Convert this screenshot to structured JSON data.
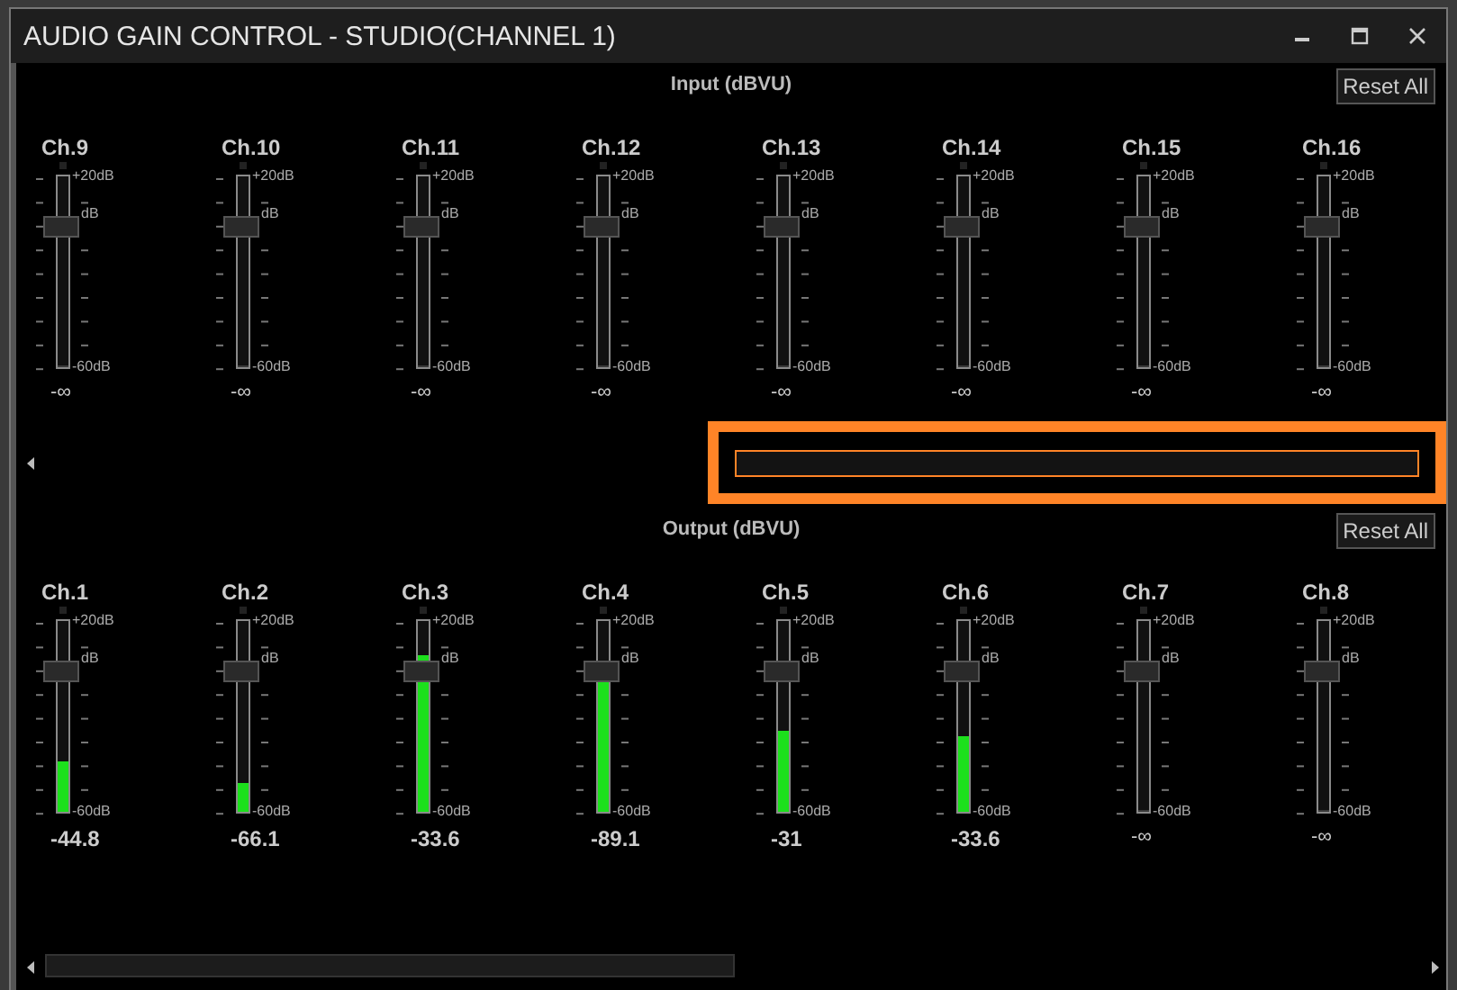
{
  "window": {
    "title": "AUDIO GAIN CONTROL - STUDIO(CHANNEL 1)"
  },
  "panels": [
    {
      "title": "Input (dBVU)",
      "reset_button": "Reset All",
      "channels": [
        {
          "name": "Ch.9",
          "scale_top": "+20dB",
          "scale_mid": "dB",
          "scale_bottom": "-60dB",
          "fader": {
            "level": 0.76
          },
          "meter": {
            "level": 0
          },
          "reading": "-∞"
        },
        {
          "name": "Ch.10",
          "scale_top": "+20dB",
          "scale_mid": "dB",
          "scale_bottom": "-60dB",
          "fader": {
            "level": 0.76
          },
          "meter": {
            "level": 0
          },
          "reading": "-∞"
        },
        {
          "name": "Ch.11",
          "scale_top": "+20dB",
          "scale_mid": "dB",
          "scale_bottom": "-60dB",
          "fader": {
            "level": 0.76
          },
          "meter": {
            "level": 0
          },
          "reading": "-∞"
        },
        {
          "name": "Ch.12",
          "scale_top": "+20dB",
          "scale_mid": "dB",
          "scale_bottom": "-60dB",
          "fader": {
            "level": 0.76
          },
          "meter": {
            "level": 0
          },
          "reading": "-∞"
        },
        {
          "name": "Ch.13",
          "scale_top": "+20dB",
          "scale_mid": "dB",
          "scale_bottom": "-60dB",
          "fader": {
            "level": 0.76
          },
          "meter": {
            "level": 0
          },
          "reading": "-∞"
        },
        {
          "name": "Ch.14",
          "scale_top": "+20dB",
          "scale_mid": "dB",
          "scale_bottom": "-60dB",
          "fader": {
            "level": 0.76
          },
          "meter": {
            "level": 0
          },
          "reading": "-∞"
        },
        {
          "name": "Ch.15",
          "scale_top": "+20dB",
          "scale_mid": "dB",
          "scale_bottom": "-60dB",
          "fader": {
            "level": 0.76
          },
          "meter": {
            "level": 0
          },
          "reading": "-∞"
        },
        {
          "name": "Ch.16",
          "scale_top": "+20dB",
          "scale_mid": "dB",
          "scale_bottom": "-60dB",
          "fader": {
            "level": 0.76
          },
          "meter": {
            "level": 0
          },
          "reading": "-∞"
        }
      ]
    },
    {
      "title": "Output (dBVU)",
      "reset_button": "Reset All",
      "channels": [
        {
          "name": "Ch.1",
          "scale_top": "+20dB",
          "scale_mid": "dB",
          "scale_bottom": "-60dB",
          "fader": {
            "level": 0.76
          },
          "meter": {
            "level": 0.26
          },
          "reading": "-44.8"
        },
        {
          "name": "Ch.2",
          "scale_top": "+20dB",
          "scale_mid": "dB",
          "scale_bottom": "-60dB",
          "fader": {
            "level": 0.76
          },
          "meter": {
            "level": 0.15
          },
          "reading": "-66.1"
        },
        {
          "name": "Ch.3",
          "scale_top": "+20dB",
          "scale_mid": "dB",
          "scale_bottom": "-60dB",
          "fader": {
            "level": 0.76
          },
          "meter": {
            "level": 0.82
          },
          "reading": "-33.6"
        },
        {
          "name": "Ch.4",
          "scale_top": "+20dB",
          "scale_mid": "dB",
          "scale_bottom": "-60dB",
          "fader": {
            "level": 0.76
          },
          "meter": {
            "level": 0.7
          },
          "reading": "-89.1"
        },
        {
          "name": "Ch.5",
          "scale_top": "+20dB",
          "scale_mid": "dB",
          "scale_bottom": "-60dB",
          "fader": {
            "level": 0.76
          },
          "meter": {
            "level": 0.42
          },
          "reading": "-31"
        },
        {
          "name": "Ch.6",
          "scale_top": "+20dB",
          "scale_mid": "dB",
          "scale_bottom": "-60dB",
          "fader": {
            "level": 0.76
          },
          "meter": {
            "level": 0.4
          },
          "reading": "-33.6"
        },
        {
          "name": "Ch.7",
          "scale_top": "+20dB",
          "scale_mid": "dB",
          "scale_bottom": "-60dB",
          "fader": {
            "level": 0.76
          },
          "meter": {
            "level": 0
          },
          "reading": "-∞"
        },
        {
          "name": "Ch.8",
          "scale_top": "+20dB",
          "scale_mid": "dB",
          "scale_bottom": "-60dB",
          "fader": {
            "level": 0.76
          },
          "meter": {
            "level": 0
          },
          "reading": "-∞"
        }
      ]
    }
  ]
}
